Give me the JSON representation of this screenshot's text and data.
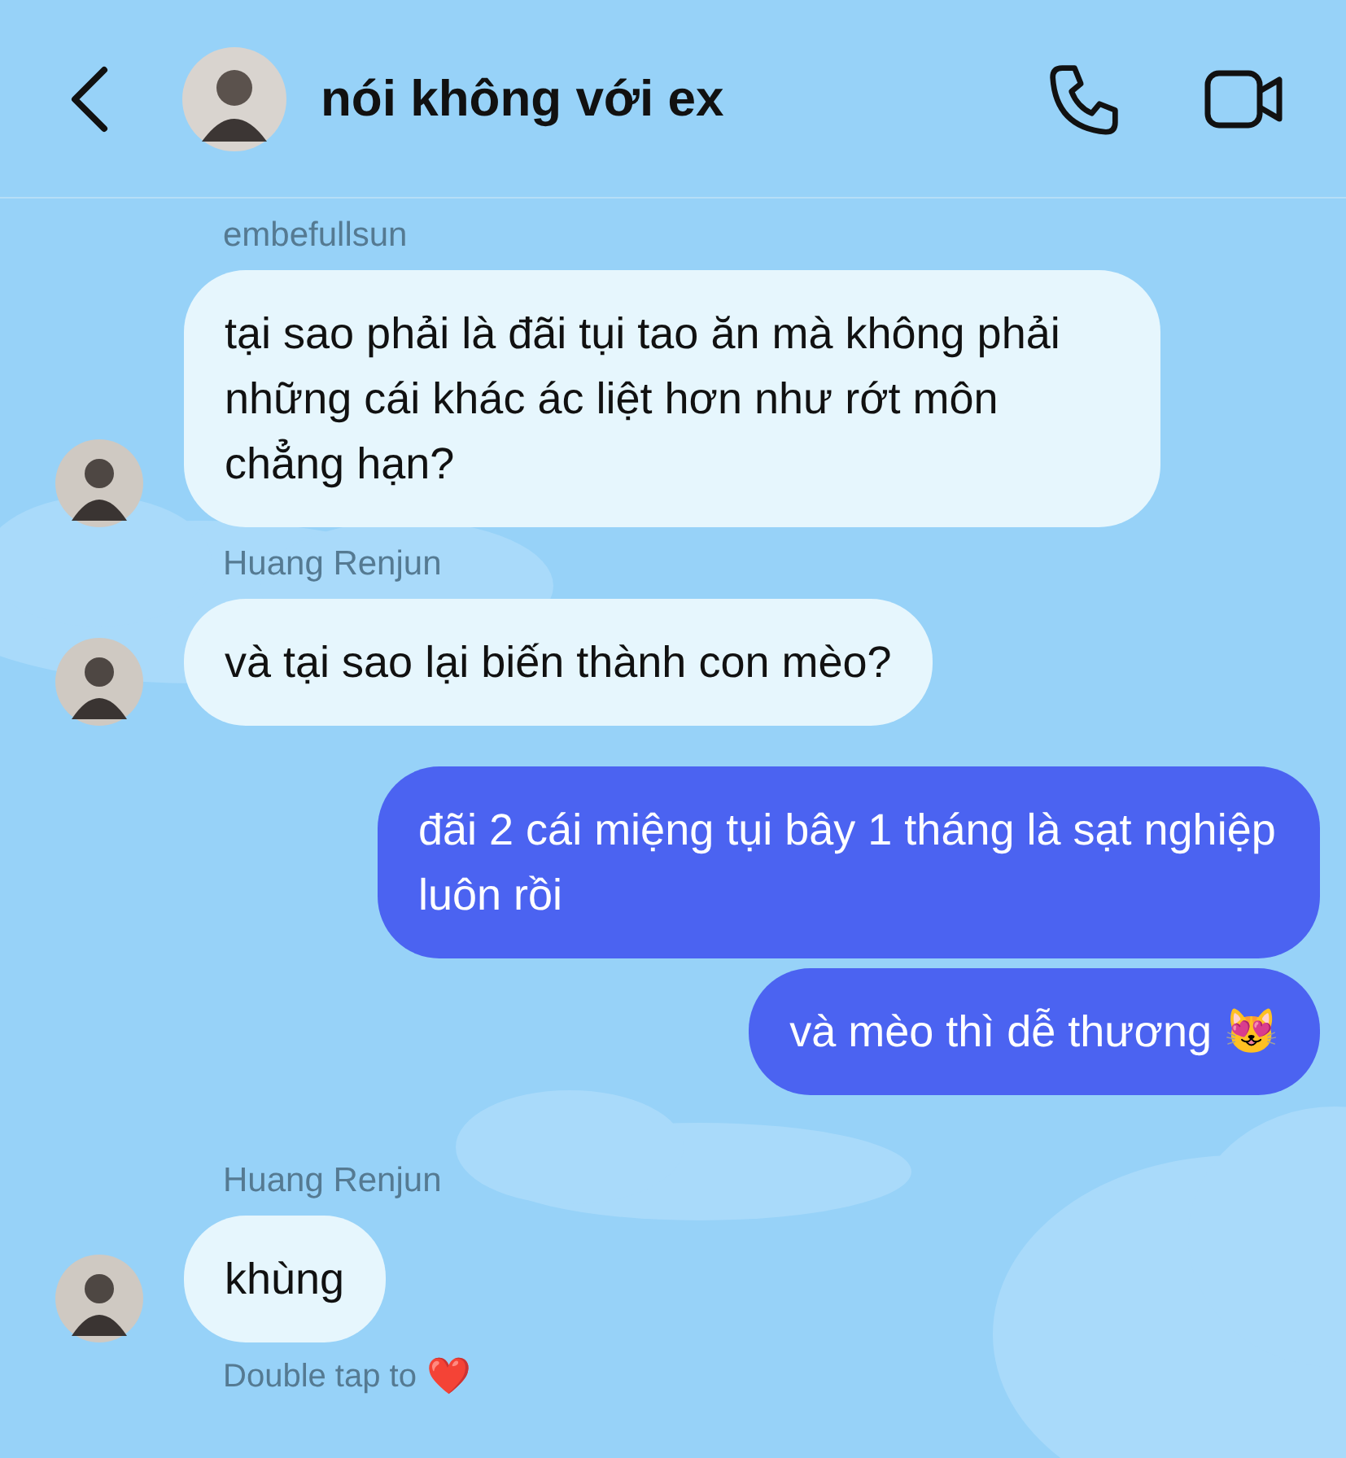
{
  "header": {
    "title": "nói không với ex"
  },
  "messages": [
    {
      "kind": "incoming",
      "sender": "embefullsun",
      "text": "tại sao phải là đãi tụi tao ăn mà không phải những cái khác ác liệt hơn như rớt môn chẳng hạn?"
    },
    {
      "kind": "incoming",
      "sender": "Huang Renjun",
      "text": "và tại sao lại biến thành con mèo?"
    },
    {
      "kind": "outgoing",
      "text": "đãi 2 cái miệng tụi bây 1 tháng là sạt nghiệp luôn rồi"
    },
    {
      "kind": "outgoing",
      "text": "và mèo thì dễ thương 😻"
    },
    {
      "kind": "incoming",
      "sender": "Huang Renjun",
      "text": "khùng"
    }
  ],
  "hint": {
    "text": "Double tap to",
    "emoji": "❤️"
  }
}
